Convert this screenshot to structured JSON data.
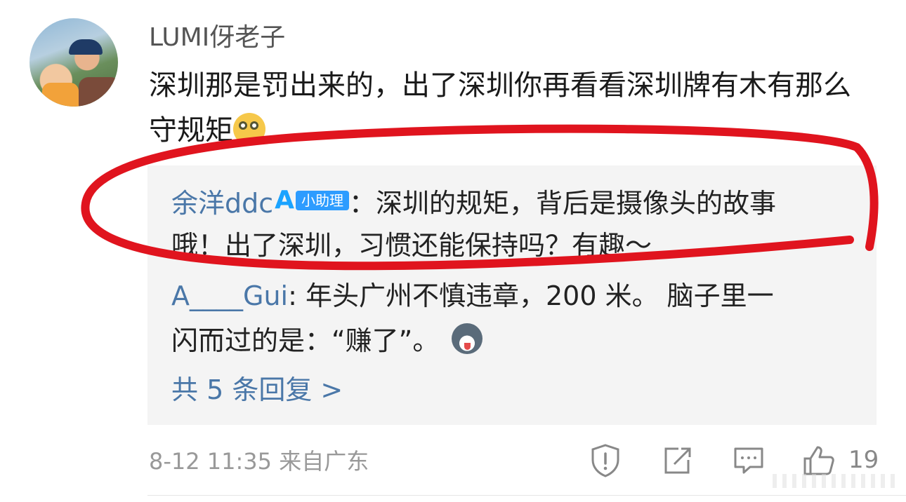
{
  "comment": {
    "username": "LUMI伢老子",
    "text": "深圳那是罚出来的，出了深圳你再看看深圳牌有木有那么守规矩",
    "timestamp": "8-12 11:35",
    "location": "来自广东",
    "like_count": "19"
  },
  "replies": [
    {
      "name": "余洋ddc",
      "badge_ai": "A",
      "badge_label": "小助理",
      "text_line1": "：深圳的规矩，背后是摄像头的故事",
      "text_line2": "哦！出了深圳，习惯还能保持吗？有趣～"
    },
    {
      "name": "A____Gui",
      "text_line1": ": 年头广州不慎违章，200 米。 脑子里一",
      "text_line2": "闪而过的是：“赚了”。"
    }
  ],
  "more_replies_label": "共 5 条回复 >",
  "icons": [
    "report-icon",
    "share-icon",
    "comment-icon",
    "like-icon"
  ],
  "colors": {
    "link": "#4a77a8",
    "badge": "#2d9cff",
    "annotation": "#e0141e"
  }
}
